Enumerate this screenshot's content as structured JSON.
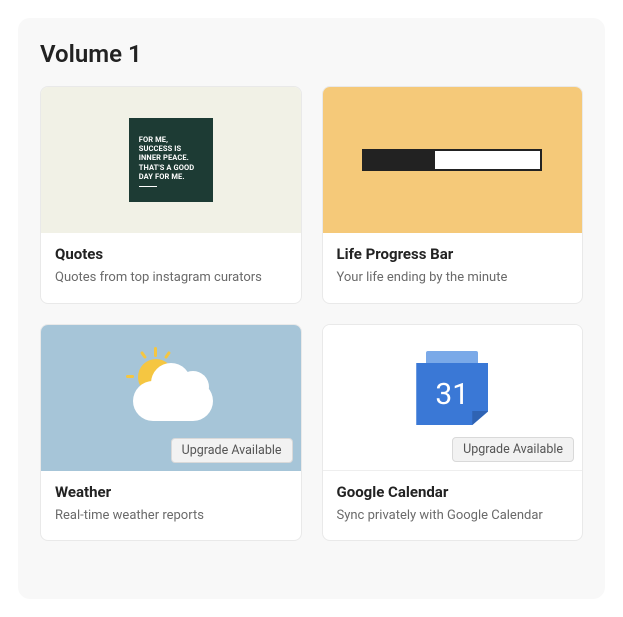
{
  "section": {
    "title": "Volume 1"
  },
  "badge_label": "Upgrade Available",
  "calendar_day": "31",
  "quote_text": "FOR ME, SUCCESS IS INNER PEACE. THAT'S A GOOD DAY FOR ME.",
  "cards": [
    {
      "title": "Quotes",
      "description": "Quotes from top instagram curators",
      "has_badge": false
    },
    {
      "title": "Life Progress Bar",
      "description": "Your life ending by the minute",
      "has_badge": false
    },
    {
      "title": "Weather",
      "description": "Real-time weather reports",
      "has_badge": true
    },
    {
      "title": "Google Calendar",
      "description": "Sync privately with Google Calendar",
      "has_badge": true
    }
  ]
}
